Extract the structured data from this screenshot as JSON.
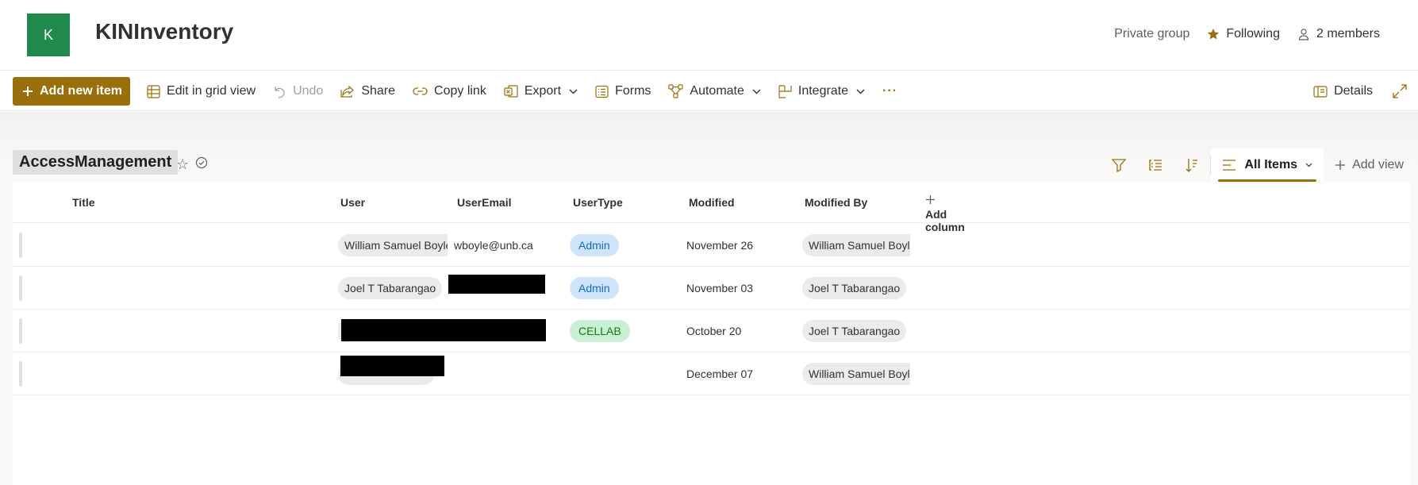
{
  "site": {
    "logo_letter": "K",
    "title": "KINInventory",
    "logo_color": "#1f8a4c",
    "privacy": "Private group",
    "following": "Following",
    "members": "2 members"
  },
  "toolbar": {
    "add_new_item": "Add new item",
    "edit_grid": "Edit in grid view",
    "undo": "Undo",
    "share": "Share",
    "copy_link": "Copy link",
    "export": "Export",
    "forms": "Forms",
    "automate": "Automate",
    "integrate": "Integrate",
    "more": "···",
    "details": "Details",
    "accent_color": "#986f0b"
  },
  "list": {
    "name": "AccessManagement",
    "view_name": "All Items",
    "add_view": "Add view"
  },
  "columns": {
    "title": "Title",
    "user": "User",
    "user_email": "UserEmail",
    "user_type": "UserType",
    "modified": "Modified",
    "modified_by": "Modified By",
    "add_column": "Add column"
  },
  "rows": [
    {
      "title": "",
      "user": "William Samuel Boyle",
      "user_email": "wboyle@unb.ca",
      "user_type": "Admin",
      "modified": "November 26",
      "modified_by": "William Samuel Boyle"
    },
    {
      "title": "",
      "user": "Joel T Tabarangao",
      "user_email": "",
      "user_type": "Admin",
      "modified": "November 03",
      "modified_by": "Joel T Tabarangao"
    },
    {
      "title": "",
      "user": "",
      "user_email": "",
      "user_type": "CELLAB",
      "modified": "October 20",
      "modified_by": "Joel T Tabarangao"
    },
    {
      "title": "",
      "user": "",
      "user_email": "",
      "user_type": "",
      "modified": "December 07",
      "modified_by": "William Samuel Boyle"
    }
  ],
  "icons": [
    "plus-icon",
    "grid-icon",
    "undo-icon",
    "share-icon",
    "link-icon",
    "excel-icon",
    "forms-icon",
    "automate-icon",
    "integrate-icon",
    "more-icon",
    "details-icon",
    "expand-icon",
    "star-icon",
    "person-icon",
    "filter-icon",
    "group-icon",
    "sort-icon",
    "view-icon",
    "chevron-down-icon",
    "checkmark-circle-icon"
  ]
}
